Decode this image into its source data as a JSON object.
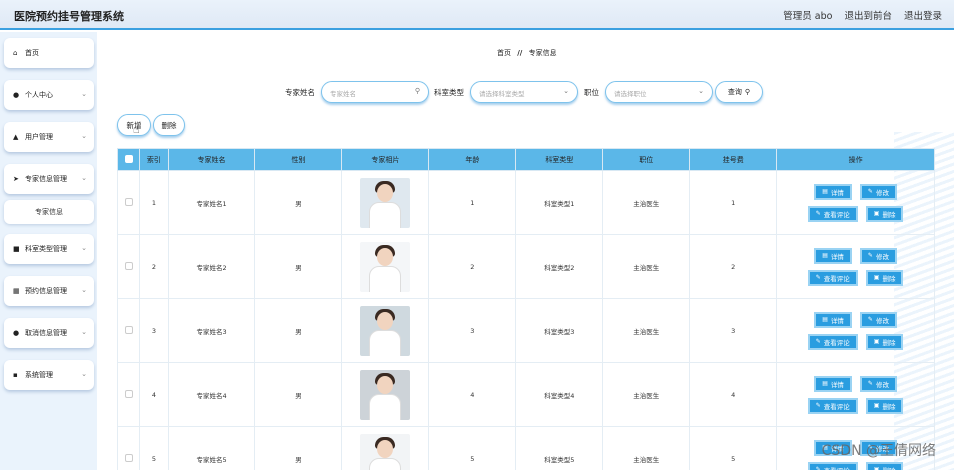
{
  "header": {
    "title": "医院预约挂号管理系统",
    "user_label": "管理员 abo",
    "front_link": "退出到前台",
    "logout_link": "退出登录"
  },
  "sidebar": {
    "items": [
      {
        "label": "首页",
        "icon": "home-icon",
        "expandable": false
      },
      {
        "label": "个人中心",
        "icon": "user-icon",
        "expandable": true
      },
      {
        "label": "用户管理",
        "icon": "user-group-icon",
        "expandable": true
      },
      {
        "label": "专家信息管理",
        "icon": "send-icon",
        "expandable": true
      },
      {
        "label": "科室类型管理",
        "icon": "monitor-icon",
        "expandable": true
      },
      {
        "label": "预约信息管理",
        "icon": "grid-icon",
        "expandable": true
      },
      {
        "label": "取消信息管理",
        "icon": "pin-icon",
        "expandable": true
      },
      {
        "label": "系统管理",
        "icon": "apps-icon",
        "expandable": true
      }
    ],
    "sub_item": "专家信息"
  },
  "breadcrumb": {
    "home": "首页",
    "sep": "//",
    "current": "专家信息"
  },
  "search": {
    "name_label": "专家姓名",
    "name_placeholder": "专家姓名",
    "dept_label": "科室类型",
    "dept_placeholder": "请选择科室类型",
    "title_label": "职位",
    "title_placeholder": "请选择职位",
    "query_label": "查询"
  },
  "actions": {
    "add_label": "新增",
    "delete_label": "删除"
  },
  "table": {
    "headers": [
      "索引",
      "专家姓名",
      "性别",
      "专家相片",
      "年龄",
      "科室类型",
      "职位",
      "挂号费",
      "操作"
    ],
    "rows": [
      {
        "index": "1",
        "name": "专家姓名1",
        "gender": "男",
        "age": "1",
        "dept": "科室类型1",
        "title": "主治医生",
        "fee": "1"
      },
      {
        "index": "2",
        "name": "专家姓名2",
        "gender": "男",
        "age": "2",
        "dept": "科室类型2",
        "title": "主治医生",
        "fee": "2"
      },
      {
        "index": "3",
        "name": "专家姓名3",
        "gender": "男",
        "age": "3",
        "dept": "科室类型3",
        "title": "主治医生",
        "fee": "3"
      },
      {
        "index": "4",
        "name": "专家姓名4",
        "gender": "男",
        "age": "4",
        "dept": "科室类型4",
        "title": "主治医生",
        "fee": "4"
      },
      {
        "index": "5",
        "name": "专家姓名5",
        "gender": "男",
        "age": "5",
        "dept": "科室类型5",
        "title": "主治医生",
        "fee": "5"
      }
    ],
    "op_labels": {
      "detail": "详情",
      "edit": "修改",
      "comments": "查看评论",
      "delete": "删除"
    }
  },
  "watermark": "CSDN @王倩网络",
  "colors": {
    "accent": "#2a9de0",
    "header_row": "#5bb7e8",
    "sidebar_bg": "#eaf3fc"
  }
}
